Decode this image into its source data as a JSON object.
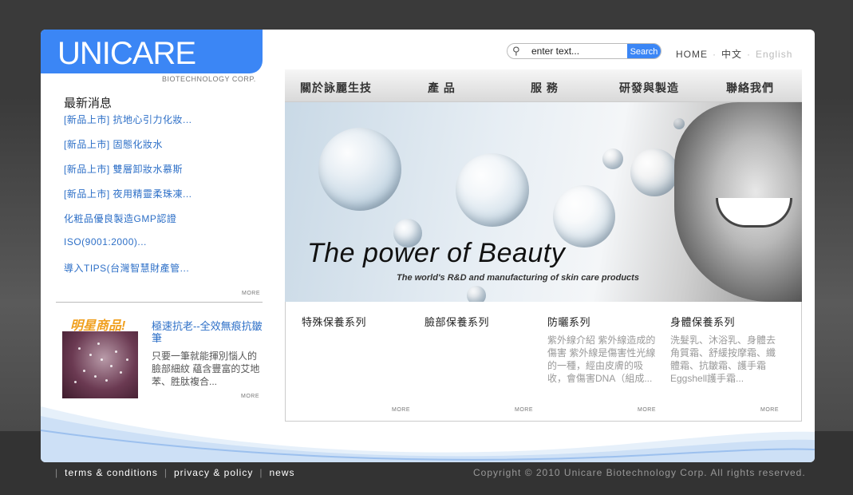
{
  "logo": {
    "text": "UNICARE",
    "sub": "BIOTECHNOLOGY CORP."
  },
  "search": {
    "placeholder": "enter text...",
    "button": "Search"
  },
  "toplinks": {
    "home": "HOME",
    "chinese": "中文",
    "english": "English"
  },
  "nav": [
    "關於詠麗生技",
    "產 品",
    "服 務",
    "研發與製造",
    "聯絡我們"
  ],
  "news": {
    "title": "最新消息",
    "items": [
      "[新品上市] 抗地心引力化妝...",
      "[新品上市] 固態化妝水",
      "[新品上市] 雙層卸妝水慕斯",
      "[新品上市] 夜用精靈柔珠凍...",
      "化粧品優良製造GMP認證",
      "ISO(9001:2000)...",
      "導入TIPS(台灣智慧財產管..."
    ],
    "more": "MORE"
  },
  "featured": {
    "title": "明星商品!",
    "link": "極速抗老--全效無痕抗皺筆",
    "desc": "只要一筆就能揮別惱人的臉部細紋 蘊含豐富的艾地苯、胜肽複合...",
    "more": "MORE"
  },
  "banner": {
    "title": "The power of Beauty",
    "subtitle": "The world's R&D and manufacturing of skin care products"
  },
  "categories": [
    {
      "title": "特殊保養系列",
      "desc": "",
      "more": "MORE"
    },
    {
      "title": "臉部保養系列",
      "desc": "",
      "more": "MORE"
    },
    {
      "title": "防曬系列",
      "desc": "紫外線介紹 紫外線造成的傷害 紫外線是傷害性光線的一種，經由皮膚的吸收，會傷害DNA（組成...",
      "more": "MORE"
    },
    {
      "title": "身體保養系列",
      "desc": "洗髮乳、沐浴乳、身體去角質霜、舒緩按摩霜、纖體霜、抗皺霜、護手霜 Eggshell護手霜...",
      "more": "MORE"
    }
  ],
  "footer": {
    "links": [
      "terms & conditions",
      "privacy & policy",
      "news"
    ],
    "copyright": "Copyright © 2010 Unicare Biotechnology Corp. All rights reserved."
  },
  "colors": {
    "accent": "#3b86f5",
    "link": "#2d6fc7"
  }
}
